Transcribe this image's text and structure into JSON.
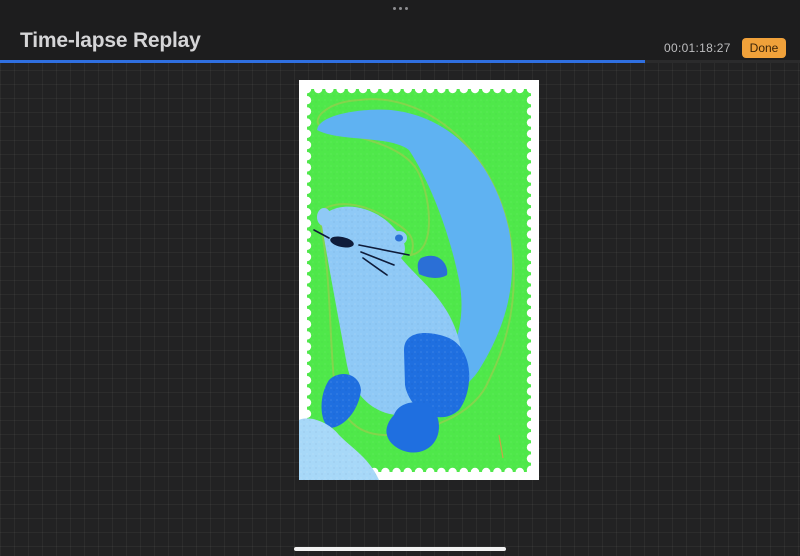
{
  "header": {
    "title": "Time-lapse Replay",
    "timecode": "00:01:18:27",
    "done_label": "Done"
  },
  "playback": {
    "progress_fraction": 0.806
  },
  "colors": {
    "background": "#222223",
    "accent_progress": "#2f6fe0",
    "done_button": "#f0a13a",
    "stamp_green": "#4fe84a",
    "otter_light_blue": "#5fb2f2",
    "otter_dark_blue": "#1f6fe0"
  },
  "icons": {
    "grabber": "more-dots-icon"
  },
  "artwork": {
    "subject": "otter-stamp-illustration"
  }
}
